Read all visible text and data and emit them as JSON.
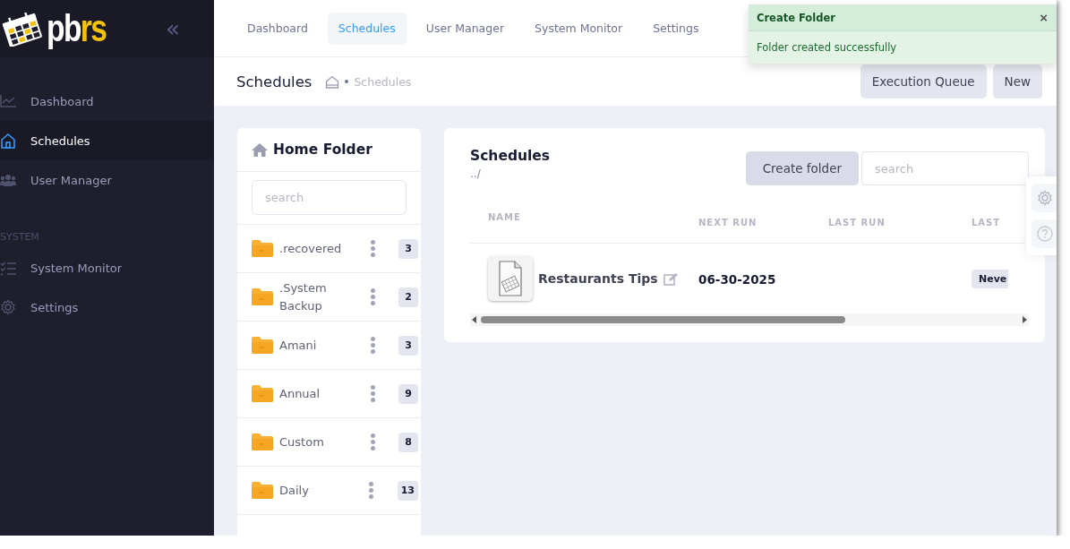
{
  "sidebar": {
    "logo": {
      "text": "pb",
      "accent": "rs"
    },
    "collapse": "«",
    "sections": [
      {
        "items": [
          {
            "label": "Dashboard",
            "selected": false
          },
          {
            "label": "Schedules",
            "selected": true
          },
          {
            "label": "User Manager",
            "selected": false
          }
        ]
      },
      {
        "title": "SYSTEM",
        "items": [
          {
            "label": "System Monitor",
            "selected": false
          },
          {
            "label": "Settings",
            "selected": false
          }
        ]
      }
    ]
  },
  "tabs": [
    {
      "label": "Dashboard",
      "selected": false
    },
    {
      "label": "Schedules",
      "selected": true
    },
    {
      "label": "User Manager",
      "selected": false
    },
    {
      "label": "System Monitor",
      "selected": false
    },
    {
      "label": "Settings",
      "selected": false
    }
  ],
  "toast": {
    "title": "Create Folder",
    "close": "×",
    "message": "Folder created successfully"
  },
  "page_header": {
    "title": "Schedules",
    "breadcrumb": [
      "Schedules"
    ],
    "buttons": [
      "Execution Queue",
      "New"
    ]
  },
  "folders": {
    "title": "Home Folder",
    "search": {
      "placeholder": "search"
    },
    "items": [
      {
        "name": ".recovered",
        "count": "3"
      },
      {
        "name": ".System Backup",
        "count": "2"
      },
      {
        "name": "Amani",
        "count": "3"
      },
      {
        "name": "Annual",
        "count": "9"
      },
      {
        "name": "Custom",
        "count": "8"
      },
      {
        "name": "Daily",
        "count": "13"
      }
    ]
  },
  "schedules": {
    "title": "Schedules",
    "path": "../",
    "create_button": "Create folder",
    "search": {
      "placeholder": "search"
    },
    "table": {
      "columns": [
        "NAME",
        "NEXT RUN",
        "LAST RUN",
        "LAST"
      ],
      "rows": [
        {
          "name": "Restaurants Tips",
          "next_run": "06-30-2025",
          "column_4": "Neve"
        }
      ]
    }
  }
}
